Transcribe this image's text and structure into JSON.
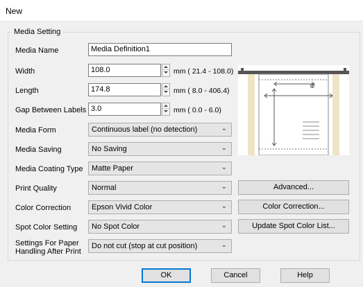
{
  "window": {
    "title": "New"
  },
  "group": {
    "legend": "Media Setting"
  },
  "labels": {
    "media_name": "Media Name",
    "width": "Width",
    "length": "Length",
    "gap": "Gap Between Labels",
    "media_form": "Media Form",
    "media_saving": "Media Saving",
    "coating": "Media Coating Type",
    "print_quality": "Print Quality",
    "color_correction": "Color Correction",
    "spot_color": "Spot Color Setting",
    "paper_handling": "Settings For Paper Handling After Print"
  },
  "fields": {
    "media_name": "Media Definition1",
    "width": "108.0",
    "length": "174.8",
    "gap": "3.0"
  },
  "ranges": {
    "width": "mm ( 21.4 - 108.0)",
    "length": "mm (  8.0 - 406.4)",
    "gap": "mm (  0.0 -   6.0)"
  },
  "dropdowns": {
    "media_form": "Continuous label (no detection)",
    "media_saving": "No Saving",
    "coating": "Matte Paper",
    "print_quality": "Normal",
    "color_correction": "Epson Vivid Color",
    "spot_color": "No Spot Color",
    "paper_handling": "Do not cut (stop at cut position)"
  },
  "buttons": {
    "advanced": "Advanced...",
    "color_correction": "Color Correction...",
    "update_spot": "Update Spot Color List...",
    "ok": "OK",
    "cancel": "Cancel",
    "help": "Help"
  },
  "icons": {
    "spinner": "spin-up-down-icon",
    "chevron": "chevron-down-icon",
    "preview": "label-dimension-diagram"
  },
  "colors": {
    "default_button_border": "#0078d7",
    "window_bg": "#f0f0f0"
  }
}
